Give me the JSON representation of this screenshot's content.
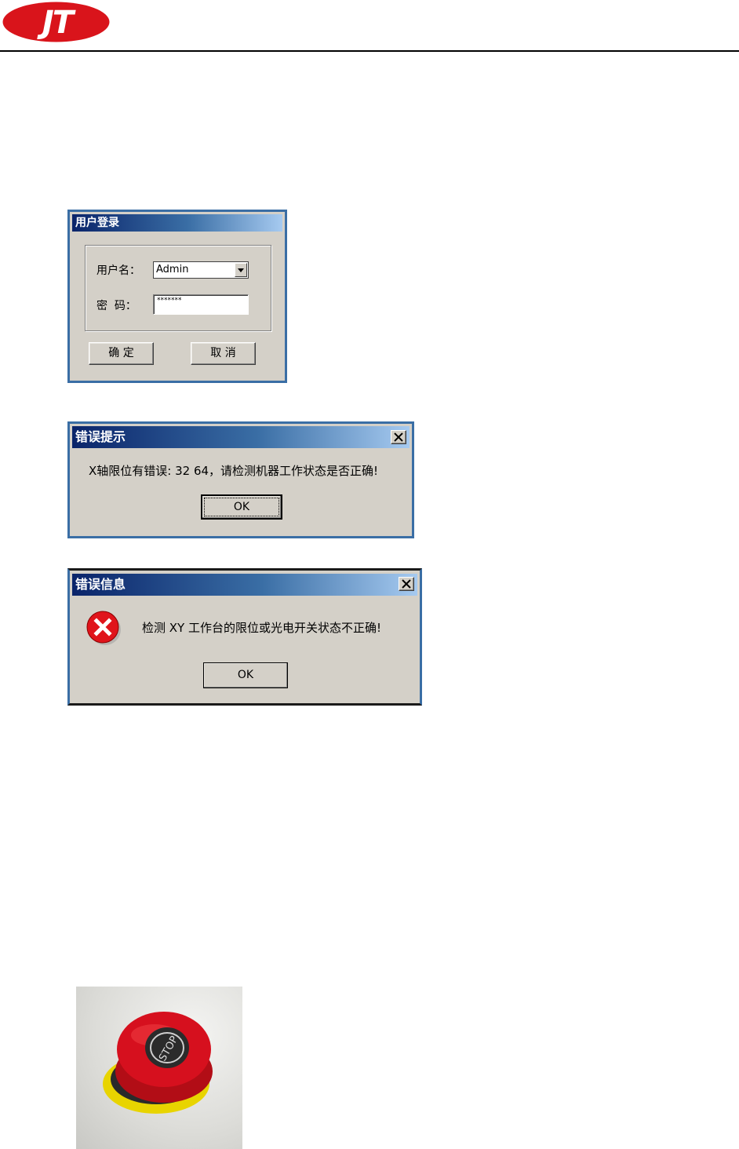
{
  "header": {
    "logo_text": "JT"
  },
  "login_dialog": {
    "title": "用户登录",
    "username_label": "用户名：",
    "username_value": "Admin",
    "password_label": "密  码：",
    "password_value": "*******",
    "ok_button": "确 定",
    "cancel_button": "取 消"
  },
  "error_tip_dialog": {
    "title": "错误提示",
    "message": "X轴限位有错误: 32 64，请检测机器工作状态是否正确!",
    "ok_button": "OK"
  },
  "error_info_dialog": {
    "title": "错误信息",
    "message": "检测 XY 工作台的限位或光电开关状态不正确!",
    "ok_button": "OK"
  },
  "stop_button_photo": {
    "label": "STOP"
  },
  "colors": {
    "logo_red": "#d9141b",
    "titlebar_dark": "#0a246a",
    "titlebar_light": "#a6caf0",
    "dialog_face": "#d4d0c8"
  }
}
